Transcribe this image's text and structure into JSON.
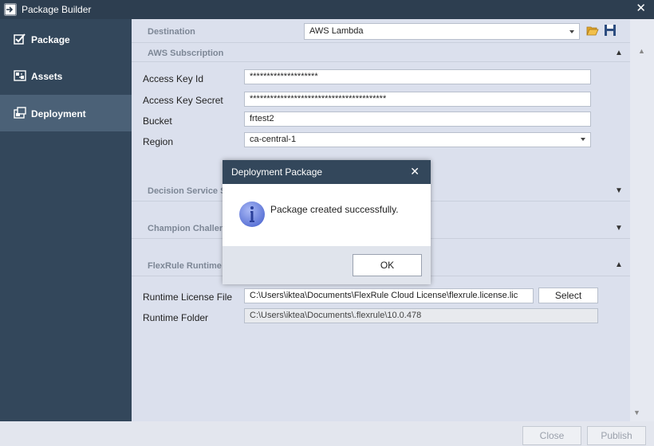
{
  "window": {
    "title": "Package Builder",
    "close_glyph": "✕",
    "icon": "package-builder-icon"
  },
  "sidebar": {
    "items": [
      {
        "label": "Package",
        "icon": "checkbox-icon",
        "active": false
      },
      {
        "label": "Assets",
        "icon": "assets-icon",
        "active": false
      },
      {
        "label": "Deployment",
        "icon": "deployment-icon",
        "active": true
      }
    ]
  },
  "destination": {
    "label": "Destination",
    "value": "AWS Lambda",
    "open_icon": "folder-open-icon",
    "save_icon": "save-icon"
  },
  "aws_subscription": {
    "header": "AWS Subscription",
    "fields": {
      "access_key_id": {
        "label": "Access Key Id",
        "value": "********************"
      },
      "access_key_secret": {
        "label": "Access Key Secret",
        "value": "****************************************"
      },
      "bucket": {
        "label": "Bucket",
        "value": "frtest2"
      },
      "region": {
        "label": "Region",
        "value": "ca-central-1"
      }
    }
  },
  "sections": {
    "decision_service": {
      "header": "Decision Service Se"
    },
    "champion_challenger": {
      "header": "Champion Challen"
    },
    "flexrule_runtime": {
      "header": "FlexRule Runtime"
    }
  },
  "runtime": {
    "license_file": {
      "label": "Runtime License File",
      "value": "C:\\Users\\iktea\\Documents\\FlexRule Cloud License\\flexrule.license.lic"
    },
    "select_label": "Select",
    "folder": {
      "label": "Runtime Folder",
      "value": "C:\\Users\\iktea\\Documents\\.flexrule\\10.0.478"
    }
  },
  "footer": {
    "close_label": "Close",
    "publish_label": "Publish"
  },
  "dialog": {
    "title": "Deployment Package",
    "close_glyph": "✕",
    "message": "Package created successfully.",
    "ok_label": "OK",
    "icon": "info-icon"
  },
  "colors": {
    "dark_navy": "#2d3e50",
    "sidebar": "#33475b",
    "sidebar_active": "#4b6177",
    "content_bg": "#dbe0ed",
    "info_blue": "#6f86e0"
  }
}
